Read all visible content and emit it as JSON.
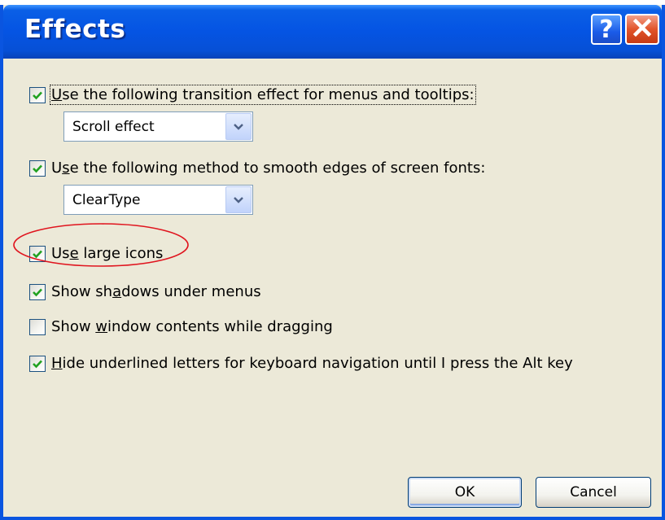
{
  "window": {
    "title": "Effects",
    "help_label": "?",
    "close_label": "×"
  },
  "options": [
    {
      "pre": "",
      "mnemonic": "U",
      "post": "se the following transition effect for menus and tooltips:",
      "checked": true
    },
    {
      "pre": "U",
      "mnemonic": "s",
      "post": "e the following method to smooth edges of screen fonts:",
      "checked": true
    },
    {
      "pre": "Us",
      "mnemonic": "e",
      "post": " large icons",
      "checked": true
    },
    {
      "pre": "Show sh",
      "mnemonic": "a",
      "post": "dows under menus",
      "checked": true
    },
    {
      "pre": "Show ",
      "mnemonic": "w",
      "post": "indow contents while dragging",
      "checked": false
    },
    {
      "pre": "",
      "mnemonic": "H",
      "post": "ide underlined letters for keyboard navigation until I press the Alt key",
      "checked": true
    }
  ],
  "dropdowns": {
    "transition": {
      "selected": "Scroll effect"
    },
    "smoothing": {
      "selected": "ClearType"
    }
  },
  "buttons": {
    "ok": "OK",
    "cancel": "Cancel"
  },
  "colors": {
    "titlebar": "#0554e3",
    "dialog_bg": "#ece9d8",
    "check": "#21a121",
    "annotation": "#e0141e"
  },
  "icons": {
    "help": "question-mark-icon",
    "close": "close-x-icon",
    "dropdown": "chevron-down-icon",
    "check": "checkmark-icon"
  }
}
